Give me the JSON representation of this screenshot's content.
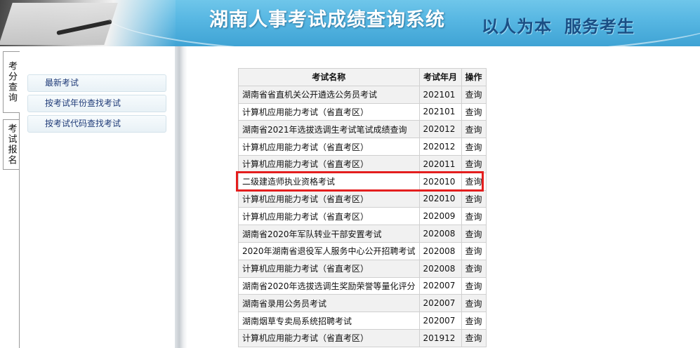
{
  "header": {
    "title": "湖南人事考试成绩查询系统",
    "slogan_part1": "以人为本",
    "slogan_part2": "服务考生"
  },
  "tabs": [
    {
      "label": "考分查询",
      "active": true
    },
    {
      "label": "考试报名",
      "active": false
    }
  ],
  "nav": [
    {
      "label": "最新考试"
    },
    {
      "label": "按考试年份查找考试"
    },
    {
      "label": "按考试代码查找考试"
    }
  ],
  "table": {
    "headers": [
      "考试名称",
      "考试年月",
      "操作"
    ],
    "rows": [
      {
        "name": "湖南省省直机关公开遴选公务员考试",
        "ym": "202101",
        "op": "查询"
      },
      {
        "name": "计算机应用能力考试（省直考区）",
        "ym": "202101",
        "op": "查询"
      },
      {
        "name": "湖南省2021年选拔选调生考试笔试成绩查询",
        "ym": "202012",
        "op": "查询"
      },
      {
        "name": "计算机应用能力考试（省直考区）",
        "ym": "202012",
        "op": "查询"
      },
      {
        "name": "计算机应用能力考试（省直考区）",
        "ym": "202011",
        "op": "查询"
      },
      {
        "name": "二级建造师执业资格考试",
        "ym": "202010",
        "op": "查询"
      },
      {
        "name": "计算机应用能力考试（省直考区）",
        "ym": "202010",
        "op": "查询"
      },
      {
        "name": "计算机应用能力考试（省直考区）",
        "ym": "202009",
        "op": "查询"
      },
      {
        "name": "湖南省2020年军队转业干部安置考试",
        "ym": "202008",
        "op": "查询"
      },
      {
        "name": "2020年湖南省退役军人服务中心公开招聘考试",
        "ym": "202008",
        "op": "查询"
      },
      {
        "name": "计算机应用能力考试（省直考区）",
        "ym": "202008",
        "op": "查询"
      },
      {
        "name": "湖南省2020年选拔选调生奖励荣誉等量化评分",
        "ym": "202007",
        "op": "查询"
      },
      {
        "name": "湖南省录用公务员考试",
        "ym": "202007",
        "op": "查询"
      },
      {
        "name": "湖南烟草专卖局系统招聘考试",
        "ym": "202007",
        "op": "查询"
      },
      {
        "name": "计算机应用能力考试（省直考区）",
        "ym": "201912",
        "op": "查询"
      }
    ]
  },
  "colors": {
    "banner": "#56b6e2",
    "nav_text": "#1f3b78",
    "highlight": "#e41e1e"
  }
}
